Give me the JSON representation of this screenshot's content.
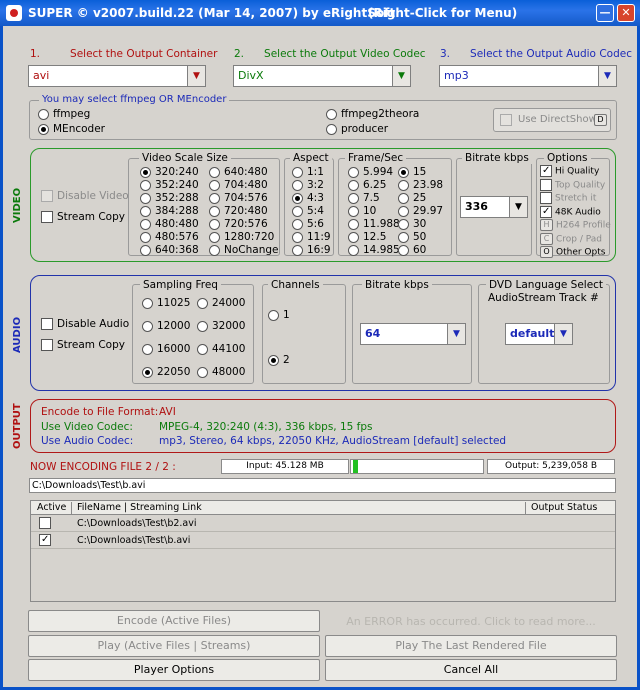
{
  "window": {
    "title": "SUPER © v2007.build.22 (Mar 14, 2007) by eRightSoft",
    "hint": "(Right-Click for Menu)"
  },
  "steps": {
    "container": {
      "num": "1.",
      "label": "Select the Output Container",
      "value": "avi"
    },
    "video_codec": {
      "num": "2.",
      "label": "Select the Output Video Codec",
      "value": "DivX"
    },
    "audio_codec": {
      "num": "3.",
      "label": "Select the Output Audio Codec",
      "value": "mp3"
    }
  },
  "encoder": {
    "label": "You may select ffmpeg OR MEncoder",
    "options": [
      "ffmpeg",
      "MEncoder",
      "ffmpeg2theora",
      "producer"
    ],
    "selected": "MEncoder",
    "directshow": "Use DirectShow",
    "directshow_btn": "D"
  },
  "video": {
    "side": "VIDEO",
    "disable": "Disable Video",
    "stream_copy": "Stream Copy",
    "scale_title": "Video Scale Size",
    "scale_col1": [
      "320:240",
      "352:240",
      "352:288",
      "384:288",
      "480:480",
      "480:576",
      "640:368"
    ],
    "scale_col2": [
      "640:480",
      "704:480",
      "704:576",
      "720:480",
      "720:576",
      "1280:720",
      "NoChange"
    ],
    "scale_selected": "320:240",
    "aspect_title": "Aspect",
    "aspects": [
      "1:1",
      "3:2",
      "4:3",
      "5:4",
      "5:6",
      "11:9",
      "16:9"
    ],
    "aspect_selected": "4:3",
    "fps_title": "Frame/Sec",
    "fps_col1": [
      "5.994",
      "6.25",
      "7.5",
      "10",
      "11.988",
      "12.5",
      "14.985"
    ],
    "fps_col2": [
      "15",
      "23.98",
      "25",
      "29.97",
      "30",
      "50",
      "60"
    ],
    "fps_selected": "15",
    "bitrate_title": "Bitrate  kbps",
    "bitrate": "336",
    "options_title": "Options",
    "opts": [
      {
        "label": "Hi Quality",
        "kind": "chk",
        "on": true
      },
      {
        "label": "Top Quality",
        "kind": "chk",
        "on": false,
        "dim": true
      },
      {
        "label": "Stretch it",
        "kind": "chk",
        "on": false,
        "dim": true
      },
      {
        "label": "48K Audio",
        "kind": "chk",
        "on": true
      },
      {
        "label": "H264 Profile",
        "kind": "btn",
        "key": "H",
        "dim": true
      },
      {
        "label": "Crop / Pad",
        "kind": "btn",
        "key": "C",
        "dim": true
      },
      {
        "label": "Other Opts",
        "kind": "btn",
        "key": "O",
        "dim": false
      }
    ]
  },
  "audio": {
    "side": "AUDIO",
    "disable": "Disable Audio",
    "stream_copy": "Stream Copy",
    "sampling_title": "Sampling Freq",
    "freq_col1": [
      "11025",
      "12000",
      "16000",
      "22050"
    ],
    "freq_col2": [
      "24000",
      "32000",
      "44100",
      "48000"
    ],
    "freq_selected": "22050",
    "channels_title": "Channels",
    "channels": [
      "1",
      "2"
    ],
    "channel_selected": "2",
    "bitrate_title": "Bitrate  kbps",
    "bitrate": "64",
    "dvd_title": "DVD Language Select",
    "dvd_sub": "AudioStream  Track #",
    "dvd_value": "default"
  },
  "output": {
    "side": "OUTPUT",
    "format_label": "Encode to File Format:",
    "format_value": "AVI",
    "video_label": "Use Video Codec:",
    "video_value": "MPEG-4,  320:240 (4:3),  336 kbps,  15 fps",
    "audio_label": "Use Audio Codec:",
    "audio_value": "mp3,  Stereo,  64 kbps,  22050 KHz,  AudioStream [default] selected"
  },
  "progress": {
    "status": "NOW ENCODING FILE 2 / 2 :",
    "input": "Input: 45.128 MB",
    "output": "Output: 5,239,058 B",
    "percent": 4,
    "current_path": "C:\\Downloads\\Test\\b.avi"
  },
  "table": {
    "headers": [
      "Active",
      "FileName  |  Streaming Link",
      "Output Status"
    ],
    "rows": [
      {
        "checked": false,
        "file": "C:\\Downloads\\Test\\b2.avi",
        "status": ""
      },
      {
        "checked": true,
        "file": "C:\\Downloads\\Test\\b.avi",
        "status": ""
      }
    ]
  },
  "buttons": {
    "encode": "Encode (Active Files)",
    "error": "An ERROR has occurred. Click to read more...",
    "play_active": "Play (Active Files | Streams)",
    "play_last": "Play The Last Rendered File",
    "player_options": "Player Options",
    "cancel_all": "Cancel All"
  }
}
